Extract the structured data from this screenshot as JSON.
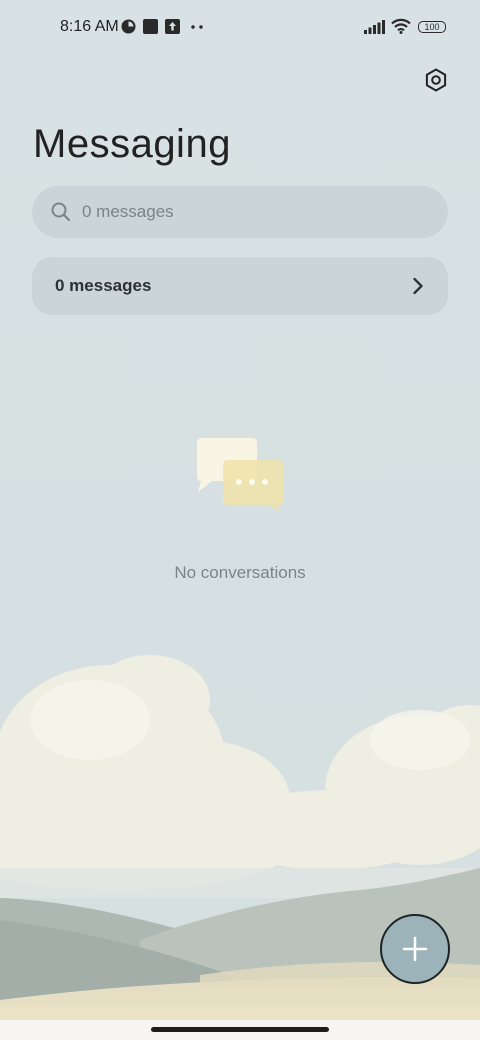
{
  "status_bar": {
    "time": "8:16 AM",
    "battery": "100",
    "icons": [
      "notification-app-icon",
      "square-app-icon",
      "upload-icon",
      "more-dots-icon",
      "signal-icon",
      "wifi-icon",
      "battery-icon"
    ]
  },
  "header": {
    "title": "Messaging",
    "settings_icon": "settings-hexagon-icon"
  },
  "search": {
    "placeholder": "0 messages",
    "icon": "search-icon"
  },
  "summary": {
    "label": "0 messages",
    "icon": "chevron-right-icon"
  },
  "empty_state": {
    "text": "No conversations",
    "icon": "chat-bubbles-icon"
  },
  "fab": {
    "icon": "plus-icon"
  },
  "colors": {
    "background": "#d7e1e3",
    "card": "#cbd4d7",
    "fab": "#9cb3b9"
  }
}
